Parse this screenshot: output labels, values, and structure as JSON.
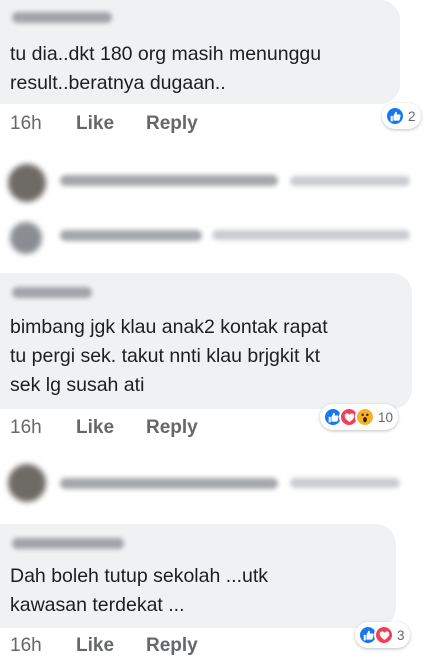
{
  "comments": [
    {
      "author": "Nawal CM Noh",
      "text": "tu dia..dkt 180 org masih menunggu\nresult..beratnya dugaan..",
      "time": "16h",
      "like_label": "Like",
      "reply_label": "Reply",
      "reaction_count": "2",
      "reactions": [
        "like"
      ]
    },
    {
      "author": "Ruhaiza Ab",
      "text": "bimbang jgk klau anak2 kontak rapat\ntu pergi sek. takut nnti klau brjgkit kt\nsek lg susah ati",
      "time": "16h",
      "like_label": "Like",
      "reply_label": "Reply",
      "reaction_count": "10",
      "reactions": [
        "like",
        "love",
        "wow"
      ]
    },
    {
      "author": "Alawe Yusoff",
      "text": "Dah boleh tutup sekolah ...utk\nkawasan terdekat ...",
      "time": "16h",
      "like_label": "Like",
      "reply_label": "Reply",
      "reaction_count": "3",
      "reactions": [
        "like",
        "love"
      ]
    }
  ],
  "collapsed_replies": [
    {
      "author": "Sahal Sufwan Hamidon",
      "preview": "pg lapisan tin..."
    },
    {
      "author": "Nawal CM Noh",
      "preview": "Sahal Sufwan Hamidon..."
    },
    {
      "author": "Sahal Sufwan Hamidon",
      "preview": "Sekolah tengk..."
    }
  ],
  "colors": {
    "like": "#1877f2",
    "love": "#f33e58",
    "wow": "#f7b125",
    "bubble": "#eff1f3",
    "meta_text": "#65676b"
  },
  "icons": {
    "like": "thumbs-up-icon",
    "love": "heart-icon",
    "wow": "wow-face-icon"
  }
}
